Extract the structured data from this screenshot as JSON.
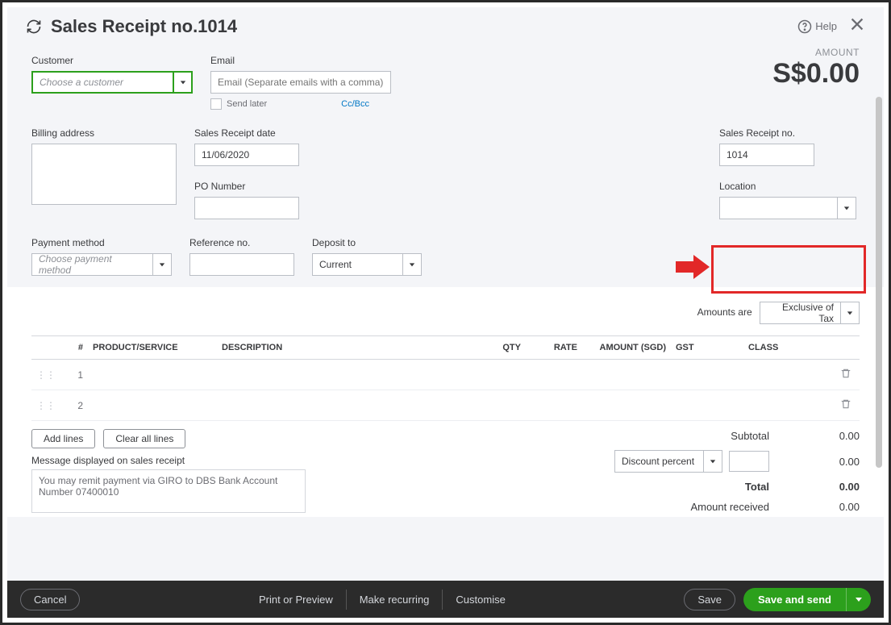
{
  "header": {
    "title": "Sales Receipt no.1014",
    "help_label": "Help"
  },
  "amount": {
    "label": "AMOUNT",
    "value": "S$0.00"
  },
  "fields": {
    "customer_label": "Customer",
    "customer_placeholder": "Choose a customer",
    "email_label": "Email",
    "email_placeholder": "Email (Separate emails with a comma)",
    "ccbcc": "Cc/Bcc",
    "send_later": "Send later",
    "billing_address_label": "Billing address",
    "receipt_date_label": "Sales Receipt date",
    "receipt_date_value": "11/06/2020",
    "po_number_label": "PO Number",
    "receipt_no_label": "Sales Receipt no.",
    "receipt_no_value": "1014",
    "location_label": "Location",
    "payment_method_label": "Payment method",
    "payment_method_placeholder": "Choose payment method",
    "reference_no_label": "Reference no.",
    "deposit_to_label": "Deposit to",
    "deposit_to_value": "Current"
  },
  "amounts_are": {
    "label": "Amounts are",
    "value": "Exclusive of Tax"
  },
  "table": {
    "headers": [
      "#",
      "PRODUCT/SERVICE",
      "DESCRIPTION",
      "QTY",
      "RATE",
      "AMOUNT (SGD)",
      "GST",
      "CLASS"
    ],
    "rows": [
      {
        "n": "1"
      },
      {
        "n": "2"
      }
    ]
  },
  "buttons": {
    "add_lines": "Add lines",
    "clear_all": "Clear all lines"
  },
  "message": {
    "label": "Message displayed on sales receipt",
    "value": "You may remit payment via GIRO to DBS Bank Account Number 07400010"
  },
  "totals": {
    "subtotal_label": "Subtotal",
    "subtotal_value": "0.00",
    "discount_label": "Discount percent",
    "discount_value": "0.00",
    "total_label": "Total",
    "total_value": "0.00",
    "amount_received_label": "Amount received",
    "amount_received_value": "0.00"
  },
  "footer": {
    "cancel": "Cancel",
    "print": "Print or Preview",
    "recurring": "Make recurring",
    "customise": "Customise",
    "save": "Save",
    "save_and_send": "Save and send"
  }
}
